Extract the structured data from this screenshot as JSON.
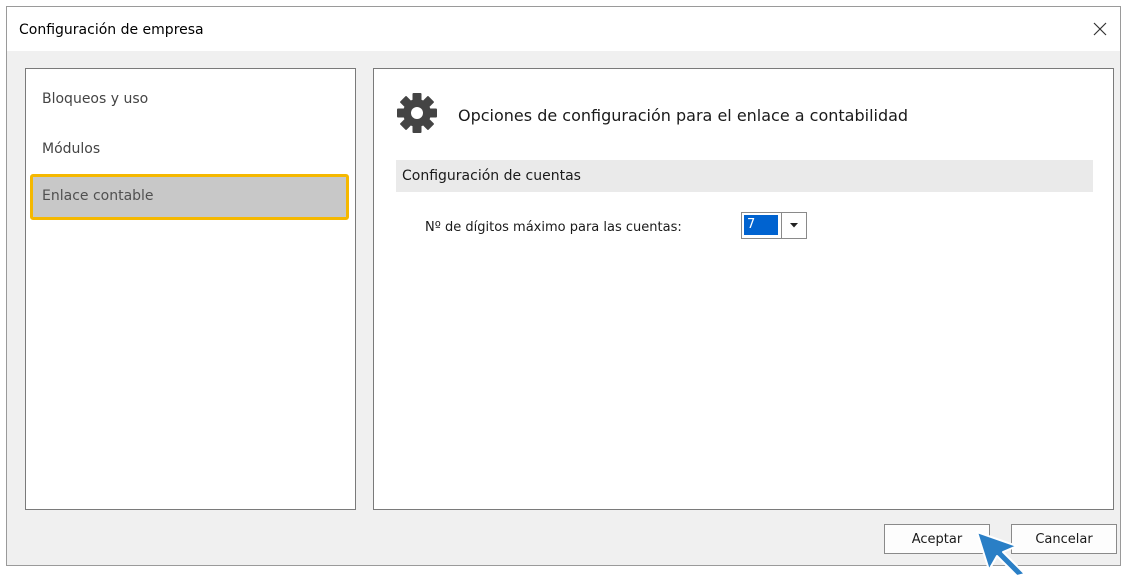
{
  "window": {
    "title": "Configuración de empresa",
    "close_icon": "close-icon"
  },
  "sidebar": {
    "items": [
      {
        "label": "Bloqueos y uso",
        "selected": false
      },
      {
        "label": "Módulos",
        "selected": false
      },
      {
        "label": "Enlace contable",
        "selected": true
      }
    ],
    "highlight_color": "#f5b800",
    "selected_bg": "#c8c8c8"
  },
  "main": {
    "header_icon": "gear-icon",
    "header_title": "Opciones de configuración para el enlace a contabilidad",
    "section_title": "Configuración de cuentas",
    "field_label": "Nº de dígitos máximo para las cuentas:",
    "field_value": "7",
    "selection_color": "#0063d0"
  },
  "footer": {
    "accept_label": "Aceptar",
    "cancel_label": "Cancelar"
  },
  "pointer": {
    "icon": "arrow-cursor-icon",
    "color": "#2a7fc6"
  }
}
